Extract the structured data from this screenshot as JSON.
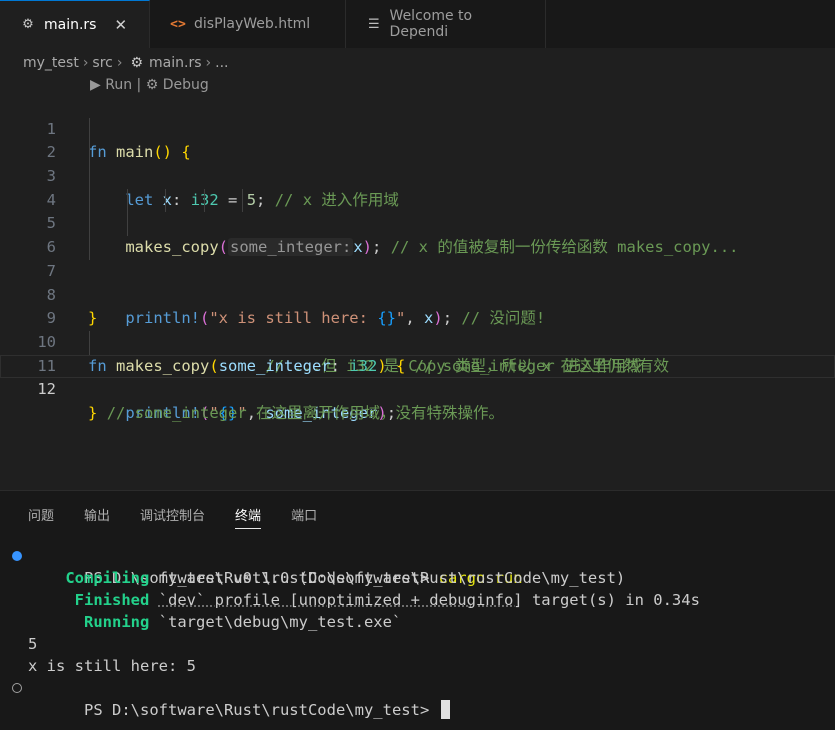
{
  "tabs": [
    {
      "label": "main.rs",
      "icon": "rust-file-icon",
      "close": "✕"
    },
    {
      "label": "disPlayWeb.html",
      "icon": "html-file-icon"
    },
    {
      "label": "Welcome to Dependi",
      "icon": "markdown-preview-icon"
    }
  ],
  "breadcrumb": {
    "folder1": "my_test",
    "folder2": "src",
    "file": "main.rs",
    "more": "..."
  },
  "codelens": {
    "run": "▶ Run",
    "sep": " | ",
    "debug": "⚙ Debug"
  },
  "line_numbers": [
    "1",
    "2",
    "3",
    "4",
    "5",
    "6",
    "7",
    "8",
    "9",
    "10",
    "11",
    "12"
  ],
  "code": {
    "l1_fn": "fn",
    "l1_name": "main",
    "l2_let": "let",
    "l2_var": "x",
    "l2_type": "i32",
    "l2_num": "5",
    "l2_comment": "// x 进入作用域",
    "l4_call": "makes_copy",
    "l4_hint": "some_integer:",
    "l4_arg": "x",
    "l4_comment": "// x 的值被复制一份传给函数 makes_copy...",
    "l5_comment": "// ...但 i32 是 Copy 类型，所以 x 在这里仍然有效",
    "l7_macro": "println!",
    "l7_str1": "\"x is still here: ",
    "l7_fmt": "{}",
    "l7_str2": "\"",
    "l7_arg": "x",
    "l7_comment": "// 没问题!",
    "l10_fn": "fn",
    "l10_name": "makes_copy",
    "l10_param": "some_integer",
    "l10_type": "i32",
    "l10_comment": "// some_integer 进入作用域",
    "l11_macro": "println!",
    "l11_str1": "\"",
    "l11_fmt": "{}",
    "l11_str2": "\"",
    "l11_arg": "some_integer",
    "l12_comment": "// some_integer 在这里离开作用域，没有特殊操作。"
  },
  "panel": {
    "tabs": [
      "问题",
      "输出",
      "调试控制台",
      "终端",
      "端口"
    ],
    "active_tab": "终端"
  },
  "terminal": {
    "prompt1": "PS D:\\software\\Rust\\rustCode\\my_test> ",
    "cmd1": "cargo run",
    "compiling_label": "Compiling",
    "compiling_text": " my_test v0.1.0 (D:\\software\\Rust\\rustCode\\my_test)",
    "finished_label": "Finished",
    "finished_pre": " ",
    "finished_profile": "`dev` profile [unoptimized + debuginfo]",
    "finished_post": " target(s) in 0.34s",
    "running_label": "Running",
    "running_text": " `target\\debug\\my_test.exe`",
    "out1": "5",
    "out2": "x is still here: 5",
    "prompt2": "PS D:\\software\\Rust\\rustCode\\my_test> "
  },
  "colors": {
    "accent": "#0078d4",
    "editor_bg": "#1f1f1f",
    "success": "#23d18b"
  }
}
